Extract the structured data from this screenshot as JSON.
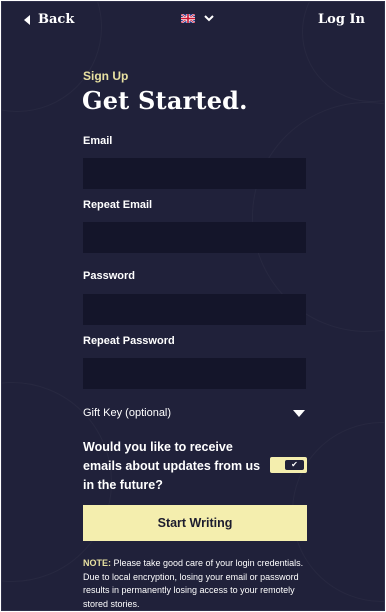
{
  "colors": {
    "background": "#20213a",
    "field_bg": "#14152a",
    "accent": "#f4eeae",
    "accent_text": "#e8e1a1"
  },
  "nav": {
    "back_label": "Back",
    "login_label": "Log In",
    "language_flag": "uk-flag-icon"
  },
  "form": {
    "eyebrow": "Sign Up",
    "title": "Get Started.",
    "email_label": "Email",
    "email_value": "",
    "repeat_email_label": "Repeat Email",
    "repeat_email_value": "",
    "password_label": "Password",
    "password_value": "",
    "repeat_password_label": "Repeat Password",
    "repeat_password_value": "",
    "gift_key_label": "Gift Key (optional)",
    "optin_text": "Would you like to receive emails about updates from us in the future?",
    "optin_checked": true,
    "submit_label": "Start Writing"
  },
  "note": {
    "prefix": "NOTE:",
    "text": " Please take good care of your login credentials. Due to local encryption, losing your email or password results in permanently losing access to your remotely stored stories."
  }
}
